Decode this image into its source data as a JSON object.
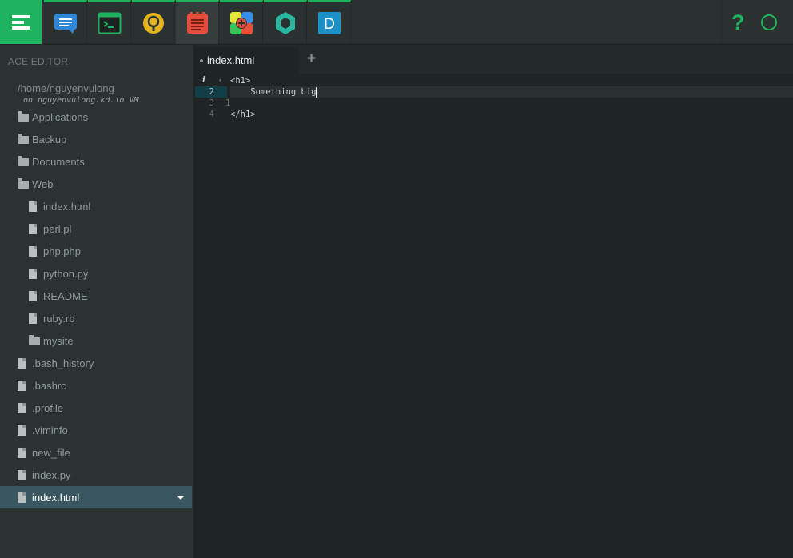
{
  "topbar": {
    "apps": [
      {
        "name": "chat",
        "color": "#2f86d6"
      },
      {
        "name": "terminal",
        "color": "#1fb35f"
      },
      {
        "name": "support",
        "color": "#e4b31f"
      },
      {
        "name": "ace-editor",
        "color": "#e34d3b"
      },
      {
        "name": "app-store",
        "color": "#e8e43a"
      },
      {
        "name": "hexagon-app",
        "color": "#2ab7a0"
      },
      {
        "name": "d-app",
        "color": "#1e90c8"
      }
    ],
    "help_label": "?",
    "accent": "#1fb35f"
  },
  "sidebar": {
    "title": "ACE EDITOR",
    "vm_path": "/home/nguyenvulong",
    "vm_host": "on nguyenvulong.kd.io VM",
    "items": [
      {
        "label": "Applications",
        "type": "folder"
      },
      {
        "label": "Backup",
        "type": "folder"
      },
      {
        "label": "Documents",
        "type": "folder"
      },
      {
        "label": "Web",
        "type": "folder-open"
      },
      {
        "label": "index.html",
        "type": "file"
      },
      {
        "label": "perl.pl",
        "type": "file"
      },
      {
        "label": "php.php",
        "type": "file"
      },
      {
        "label": "python.py",
        "type": "file"
      },
      {
        "label": "README",
        "type": "file"
      },
      {
        "label": "ruby.rb",
        "type": "file"
      },
      {
        "label": "mysite",
        "type": "folder"
      },
      {
        "label": ".bash_history",
        "type": "file"
      },
      {
        "label": ".bashrc",
        "type": "file"
      },
      {
        "label": ".profile",
        "type": "file"
      },
      {
        "label": ".viminfo",
        "type": "file"
      },
      {
        "label": "new_file",
        "type": "file"
      },
      {
        "label": "index.py",
        "type": "file"
      },
      {
        "label": "index.html",
        "type": "file",
        "selected": true
      }
    ]
  },
  "editor": {
    "tab_label": "index.html",
    "add_tab_label": "+",
    "line_numbers": [
      "1",
      "2",
      "3",
      "4"
    ],
    "lines": [
      "<h1>",
      "    Something big",
      "",
      "</h1>"
    ]
  }
}
